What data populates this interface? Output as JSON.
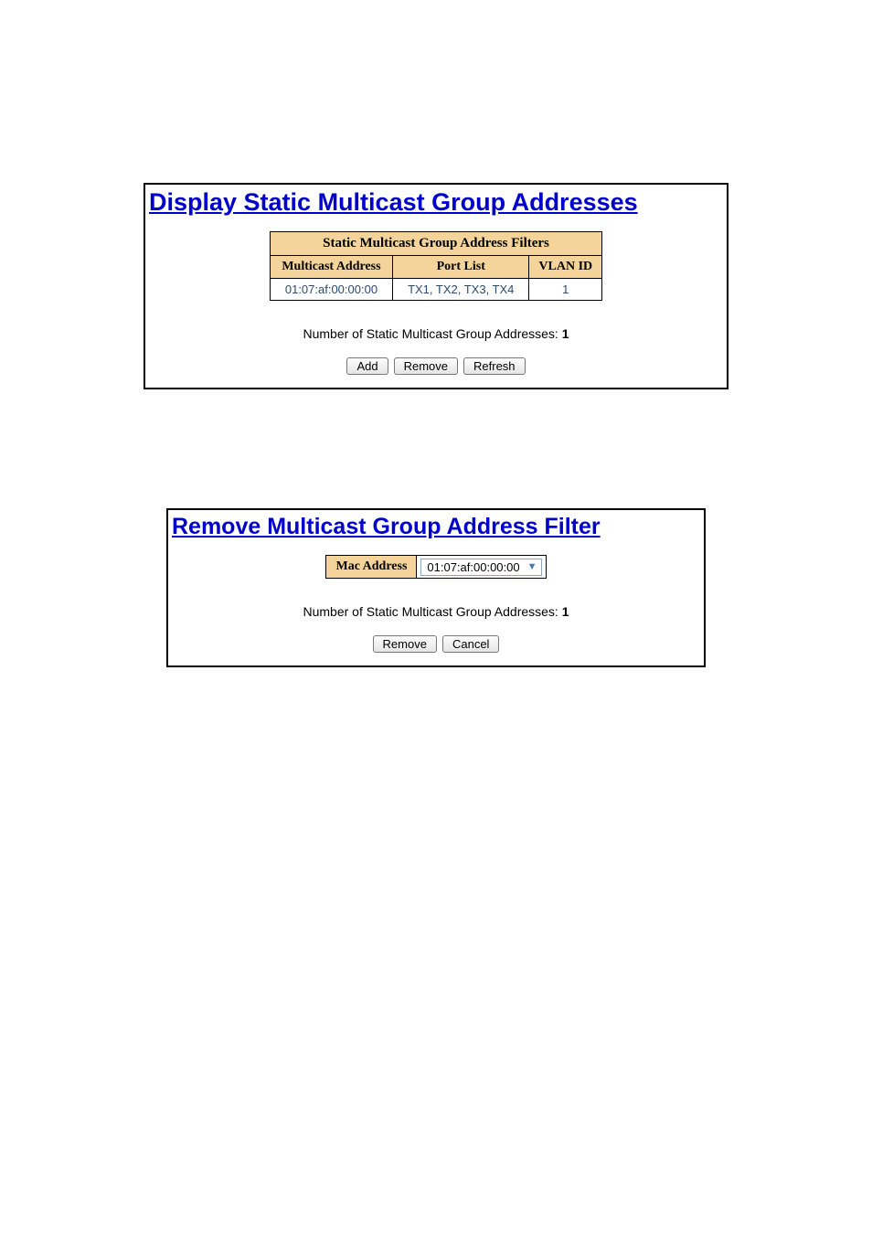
{
  "display_panel": {
    "title": "Display Static Multicast Group Addresses",
    "table_caption": "Static Multicast Group Address Filters",
    "headers": {
      "multicast_address": "Multicast Address",
      "port_list": "Port List",
      "vlan_id": "VLAN ID"
    },
    "rows": [
      {
        "multicast_address": "01:07:af:00:00:00",
        "port_list": "TX1, TX2, TX3, TX4",
        "vlan_id": "1"
      }
    ],
    "count_label_prefix": "Number of Static Multicast Group Addresses: ",
    "count_value": "1",
    "buttons": {
      "add": "Add",
      "remove": "Remove",
      "refresh": "Refresh"
    }
  },
  "remove_panel": {
    "title": "Remove Multicast Group Address Filter",
    "mac_label": "Mac Address",
    "mac_select_value": "01:07:af:00:00:00",
    "count_label_prefix": "Number of Static Multicast Group Addresses: ",
    "count_value": "1",
    "buttons": {
      "remove": "Remove",
      "cancel": "Cancel"
    }
  }
}
